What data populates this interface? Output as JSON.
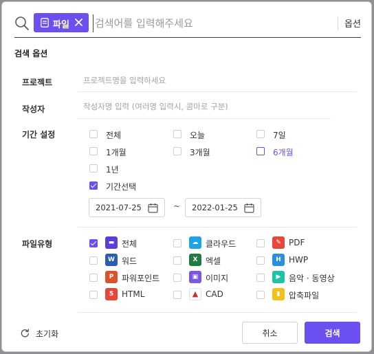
{
  "search": {
    "chip_label": "파일",
    "placeholder": "검색어를 입력해주세요",
    "value": "",
    "options_label": "옵션"
  },
  "section_title": "검색 옵션",
  "project": {
    "label": "프로젝트",
    "placeholder": "프로젝트명을 입력하세요"
  },
  "author": {
    "label": "작성자",
    "placeholder": "작성자명 입력 (여러명 입력시, 콤마로 구분)"
  },
  "period": {
    "label": "기간 설정",
    "options": [
      {
        "label": "전체",
        "checked": false
      },
      {
        "label": "오늘",
        "checked": false
      },
      {
        "label": "7일",
        "checked": false
      },
      {
        "label": "1개월",
        "checked": false
      },
      {
        "label": "3개월",
        "checked": false
      },
      {
        "label": "6개월",
        "checked": false,
        "highlighted": true
      },
      {
        "label": "1년",
        "checked": false
      },
      {
        "label": "기간선택",
        "checked": true
      }
    ],
    "start_date": "2021-07-25",
    "end_date": "2022-01-25",
    "range_separator": "~"
  },
  "filetype": {
    "label": "파일유형",
    "options": [
      {
        "label": "전체",
        "checked": true,
        "icon": "all-files-icon",
        "color": "#5b3fd6",
        "glyph": "▬"
      },
      {
        "label": "클라우드",
        "checked": false,
        "icon": "cloud-icon",
        "color": "#1fa3e8",
        "glyph": "☁"
      },
      {
        "label": "PDF",
        "checked": false,
        "icon": "pdf-icon",
        "color": "#e5483b",
        "glyph": "✎"
      },
      {
        "label": "워드",
        "checked": false,
        "icon": "word-icon",
        "color": "#2b5cb8",
        "glyph": "W"
      },
      {
        "label": "엑셀",
        "checked": false,
        "icon": "excel-icon",
        "color": "#1f7a44",
        "glyph": "X"
      },
      {
        "label": "HWP",
        "checked": false,
        "icon": "hwp-icon",
        "color": "#2b8fe0",
        "glyph": "H"
      },
      {
        "label": "파워포인트",
        "checked": false,
        "icon": "powerpoint-icon",
        "color": "#d9542b",
        "glyph": "P"
      },
      {
        "label": "이미지",
        "checked": false,
        "icon": "image-icon",
        "color": "#7e57e0",
        "glyph": "▣"
      },
      {
        "label": "음악 · 동영상",
        "checked": false,
        "icon": "media-icon",
        "color": "#22c2a8",
        "glyph": "▶"
      },
      {
        "label": "HTML",
        "checked": false,
        "icon": "html-icon",
        "color": "#e5483b",
        "glyph": "5"
      },
      {
        "label": "CAD",
        "checked": false,
        "icon": "cad-icon",
        "color": "#ffffff",
        "glyph": "▲"
      },
      {
        "label": "압축파일",
        "checked": false,
        "icon": "zip-icon",
        "color": "#f2c21b",
        "glyph": "▮"
      }
    ]
  },
  "footer": {
    "reset_label": "초기화",
    "cancel_label": "취소",
    "search_label": "검색"
  },
  "colors": {
    "accent": "#6b4ff0"
  }
}
